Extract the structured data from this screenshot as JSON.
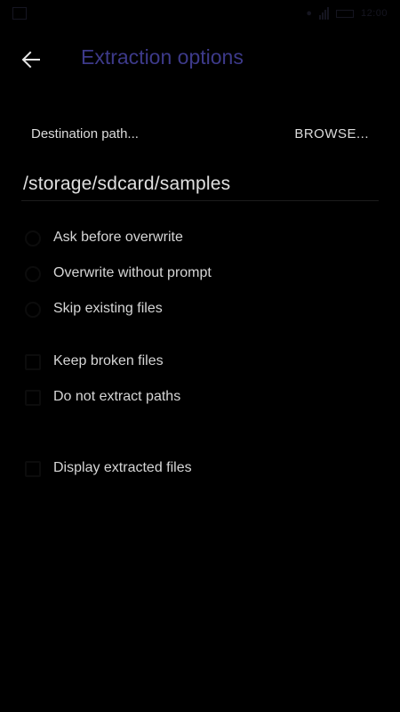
{
  "status_bar": {
    "time": "12:00"
  },
  "header": {
    "title": "Extraction options",
    "title_color": "#3d3a8a"
  },
  "destination": {
    "label": "Destination path...",
    "browse_label": "BROWSE...",
    "path_value": "/storage/sdcard/samples"
  },
  "options": {
    "ask_before_overwrite": "Ask before overwrite",
    "overwrite_without_prompt": "Overwrite without prompt",
    "skip_existing_files": "Skip existing files",
    "keep_broken_files": "Keep broken files",
    "do_not_extract_paths": "Do not extract paths",
    "display_extracted_files": "Display extracted files"
  }
}
